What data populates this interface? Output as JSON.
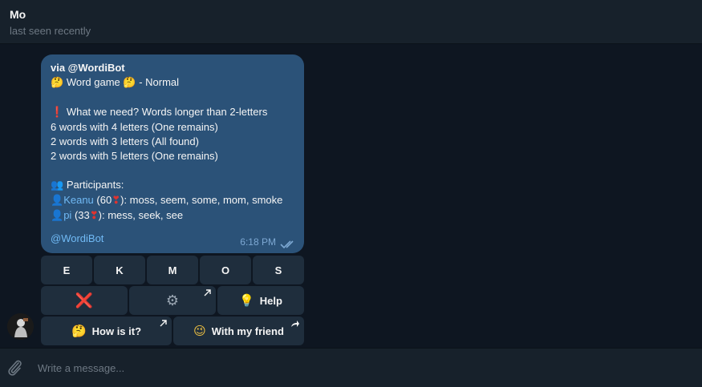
{
  "header": {
    "name": "Mo",
    "status": "last seen recently"
  },
  "message": {
    "via": "via @WordiBot",
    "title_icon": "🤔",
    "title_text": "Word game",
    "title_mode": "- Normal",
    "need_icon": "❗",
    "need_text": "What we need? Words longer than 2-letters",
    "req_1": "6 words with 4 letters (One remains)",
    "req_2": "2 words with 3 letters (All found)",
    "req_3": "2 words with 5 letters (One remains)",
    "participants_icon": "👥",
    "participants_label": "Participants:",
    "p1_icon": "👤",
    "p1_name": "Keanu",
    "p1_score_open": "(60",
    "p1_words": "): moss, seem, some, mom, smoke",
    "p2_icon": "👤",
    "p2_name": "pi",
    "p2_score_open": "(33",
    "p2_words": "): mess, seek, see",
    "heart": "❣",
    "footer": "@WordiBot",
    "time": "6:18 PM"
  },
  "keyboard": {
    "row1": [
      "E",
      "K",
      "M",
      "O",
      "S"
    ],
    "row2": {
      "cancel_icon": "❌",
      "settings_icon": "⚙",
      "help_icon": "💡",
      "help_label": "Help"
    },
    "row3": {
      "howis_icon": "🤔",
      "howis_label": "How is it?",
      "friend_icon": "😉",
      "friend_label": "With my friend"
    }
  },
  "composer": {
    "placeholder": "Write a message..."
  },
  "colors": {
    "accent": "#71baf5",
    "bubble": "#2b5278",
    "background": "#0e1621",
    "panel": "#17212b",
    "button": "#1f2e3d"
  }
}
